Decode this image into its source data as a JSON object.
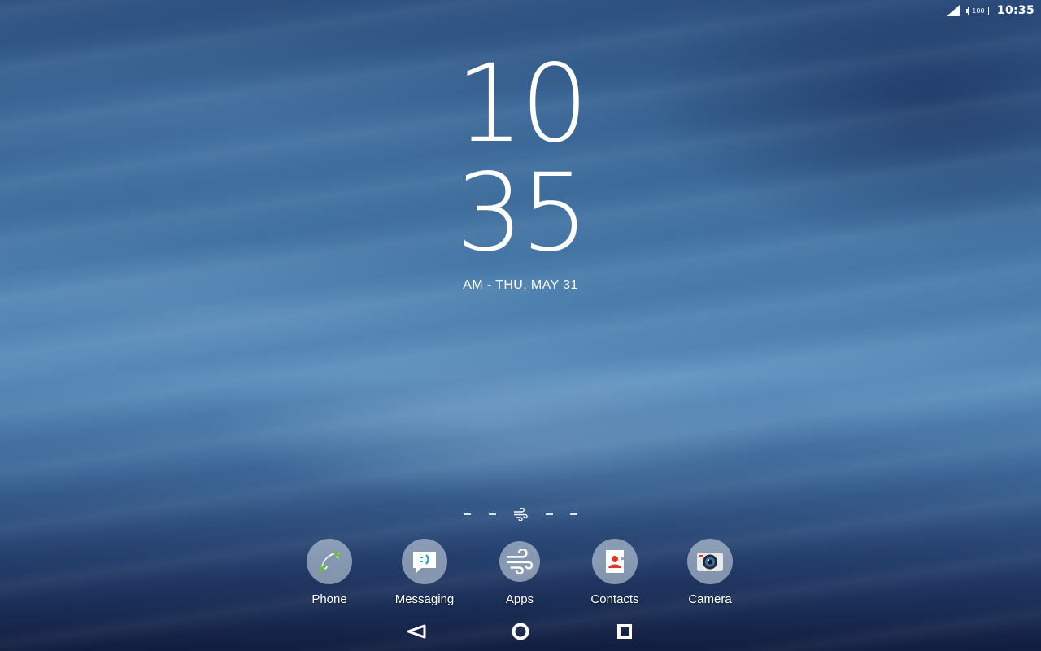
{
  "status_bar": {
    "battery_level": "100",
    "time": "10:35",
    "icons": [
      "signal-icon",
      "battery-icon"
    ]
  },
  "clock": {
    "hours": "10",
    "minutes": "35",
    "date": "AM - THU, MAY 31"
  },
  "page_indicator": {
    "pages": 5,
    "current": 2,
    "home_icon": "wind-icon"
  },
  "dock": {
    "items": [
      {
        "label": "Phone",
        "icon": "phone-icon"
      },
      {
        "label": "Messaging",
        "icon": "messaging-icon"
      },
      {
        "label": "Apps",
        "icon": "apps-icon"
      },
      {
        "label": "Contacts",
        "icon": "contacts-icon"
      },
      {
        "label": "Camera",
        "icon": "camera-icon"
      }
    ]
  },
  "nav_bar": {
    "buttons": [
      "back-icon",
      "home-icon",
      "recents-icon"
    ]
  },
  "colors": {
    "phone_accent": "#6cbf3a",
    "messaging_accent": "#2aa7c9",
    "contacts_accent": "#e2342b",
    "camera_accent": "#3a6fa8"
  }
}
